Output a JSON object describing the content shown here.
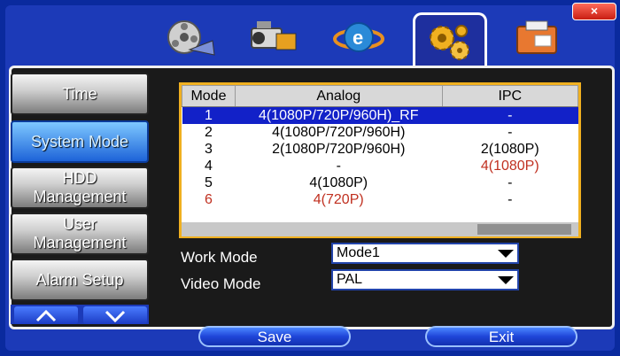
{
  "window": {
    "close_label": "×"
  },
  "tabs": [
    {
      "icon": "film-reel-icon"
    },
    {
      "icon": "camcorder-icon"
    },
    {
      "icon": "network-globe-icon"
    },
    {
      "icon": "gears-icon",
      "active": true
    },
    {
      "icon": "folder-icon"
    }
  ],
  "sidebar": {
    "items": [
      {
        "label": "Time"
      },
      {
        "label": "System Mode",
        "active": true
      },
      {
        "label_line1": "HDD",
        "label_line2": "Management"
      },
      {
        "label_line1": "User",
        "label_line2": "Management"
      },
      {
        "label": "Alarm Setup"
      }
    ]
  },
  "table": {
    "headers": [
      "Mode",
      "Analog",
      "IPC"
    ],
    "rows": [
      {
        "mode": "1",
        "analog": "4(1080P/720P/960H)_RF",
        "ipc": "-",
        "selected": true
      },
      {
        "mode": "2",
        "analog": "4(1080P/720P/960H)",
        "ipc": "-"
      },
      {
        "mode": "3",
        "analog": "2(1080P/720P/960H)",
        "ipc": "2(1080P)"
      },
      {
        "mode": "4",
        "analog": "-",
        "ipc": "4(1080P)",
        "ipc_red": true
      },
      {
        "mode": "5",
        "analog": "4(1080P)",
        "ipc": "-"
      },
      {
        "mode": "6",
        "analog": "4(720P)",
        "ipc": "-",
        "mode_red": true,
        "analog_red": true
      }
    ]
  },
  "form": {
    "work_mode_label": "Work Mode",
    "work_mode_value": "Mode1",
    "video_mode_label": "Video Mode",
    "video_mode_value": "PAL"
  },
  "buttons": {
    "save": "Save",
    "exit": "Exit"
  },
  "colors": {
    "accent_blue": "#1221c8",
    "warning_red": "#c03020",
    "table_border": "#f0b020"
  }
}
